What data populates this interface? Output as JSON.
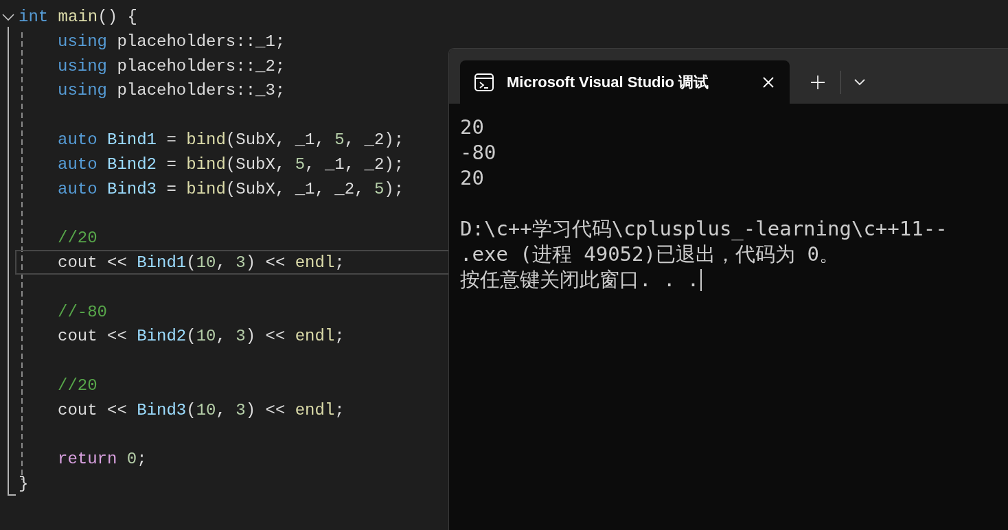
{
  "editor": {
    "fold": {
      "expanded": true
    },
    "blocks": [
      [
        {
          "kind": "open",
          "selected": false,
          "tokens": [
            {
              "kind": "keyword",
              "text": "int"
            },
            {
              "kind": "function",
              "text": " main"
            },
            {
              "kind": "plain",
              "text": "() {"
            }
          ]
        },
        {
          "kind": "body",
          "selected": false,
          "tokens": [
            {
              "kind": "keyword",
              "text": "using"
            },
            {
              "kind": "plain",
              "text": " placeholders::_1;"
            }
          ]
        },
        {
          "kind": "body",
          "selected": false,
          "tokens": [
            {
              "kind": "keyword",
              "text": "using"
            },
            {
              "kind": "plain",
              "text": " placeholders::_2;"
            }
          ]
        },
        {
          "kind": "body",
          "selected": false,
          "tokens": [
            {
              "kind": "keyword",
              "text": "using"
            },
            {
              "kind": "plain",
              "text": " placeholders::_3;"
            }
          ]
        }
      ],
      [
        {
          "kind": "body",
          "selected": false,
          "tokens": [
            {
              "kind": "keyword",
              "text": "auto"
            },
            {
              "kind": "variable",
              "text": " Bind1"
            },
            {
              "kind": "plain",
              "text": " = "
            },
            {
              "kind": "function",
              "text": "bind"
            },
            {
              "kind": "plain",
              "text": "(SubX, _1, "
            },
            {
              "kind": "number",
              "text": "5"
            },
            {
              "kind": "plain",
              "text": ", _2);"
            }
          ]
        },
        {
          "kind": "body",
          "selected": false,
          "tokens": [
            {
              "kind": "keyword",
              "text": "auto"
            },
            {
              "kind": "variable",
              "text": " Bind2"
            },
            {
              "kind": "plain",
              "text": " = "
            },
            {
              "kind": "function",
              "text": "bind"
            },
            {
              "kind": "plain",
              "text": "(SubX, "
            },
            {
              "kind": "number",
              "text": "5"
            },
            {
              "kind": "plain",
              "text": ", _1, _2);"
            }
          ]
        },
        {
          "kind": "body",
          "selected": false,
          "tokens": [
            {
              "kind": "keyword",
              "text": "auto"
            },
            {
              "kind": "variable",
              "text": " Bind3"
            },
            {
              "kind": "plain",
              "text": " = "
            },
            {
              "kind": "function",
              "text": "bind"
            },
            {
              "kind": "plain",
              "text": "(SubX, _1, _2, "
            },
            {
              "kind": "number",
              "text": "5"
            },
            {
              "kind": "plain",
              "text": ");"
            }
          ]
        }
      ],
      [
        {
          "kind": "body",
          "selected": false,
          "tokens": [
            {
              "kind": "comment",
              "text": "//20"
            }
          ]
        },
        {
          "kind": "body",
          "selected": true,
          "tokens": [
            {
              "kind": "plain",
              "text": "cout << "
            },
            {
              "kind": "variable",
              "text": "Bind1"
            },
            {
              "kind": "plain",
              "text": "("
            },
            {
              "kind": "number",
              "text": "10"
            },
            {
              "kind": "plain",
              "text": ", "
            },
            {
              "kind": "number",
              "text": "3"
            },
            {
              "kind": "plain",
              "text": ") << "
            },
            {
              "kind": "function",
              "text": "endl"
            },
            {
              "kind": "plain",
              "text": ";"
            }
          ]
        }
      ],
      [
        {
          "kind": "body",
          "selected": false,
          "tokens": [
            {
              "kind": "comment",
              "text": "//-80"
            }
          ]
        },
        {
          "kind": "body",
          "selected": false,
          "tokens": [
            {
              "kind": "plain",
              "text": "cout << "
            },
            {
              "kind": "variable",
              "text": "Bind2"
            },
            {
              "kind": "plain",
              "text": "("
            },
            {
              "kind": "number",
              "text": "10"
            },
            {
              "kind": "plain",
              "text": ", "
            },
            {
              "kind": "number",
              "text": "3"
            },
            {
              "kind": "plain",
              "text": ") << "
            },
            {
              "kind": "function",
              "text": "endl"
            },
            {
              "kind": "plain",
              "text": ";"
            }
          ]
        }
      ],
      [
        {
          "kind": "body",
          "selected": false,
          "tokens": [
            {
              "kind": "comment",
              "text": "//20"
            }
          ]
        },
        {
          "kind": "body",
          "selected": false,
          "tokens": [
            {
              "kind": "plain",
              "text": "cout << "
            },
            {
              "kind": "variable",
              "text": "Bind3"
            },
            {
              "kind": "plain",
              "text": "("
            },
            {
              "kind": "number",
              "text": "10"
            },
            {
              "kind": "plain",
              "text": ", "
            },
            {
              "kind": "number",
              "text": "3"
            },
            {
              "kind": "plain",
              "text": ") << "
            },
            {
              "kind": "function",
              "text": "endl"
            },
            {
              "kind": "plain",
              "text": ";"
            }
          ]
        }
      ],
      [
        {
          "kind": "body",
          "selected": false,
          "tokens": [
            {
              "kind": "control",
              "text": "return"
            },
            {
              "kind": "number",
              "text": " 0"
            },
            {
              "kind": "plain",
              "text": ";"
            }
          ]
        },
        {
          "kind": "close",
          "selected": false,
          "tokens": [
            {
              "kind": "plain",
              "text": "}"
            }
          ]
        }
      ]
    ]
  },
  "terminal": {
    "tabs": [
      {
        "title": "Microsoft Visual Studio 调试",
        "selected": true
      }
    ],
    "blocks": [
      [
        "20",
        "-80",
        "20"
      ],
      [
        "D:\\c++学习代码\\cplusplus_-learning\\c++11--",
        ".exe (进程 49052)已退出，代码为 0。",
        "按任意键关闭此窗口. . ."
      ]
    ]
  }
}
